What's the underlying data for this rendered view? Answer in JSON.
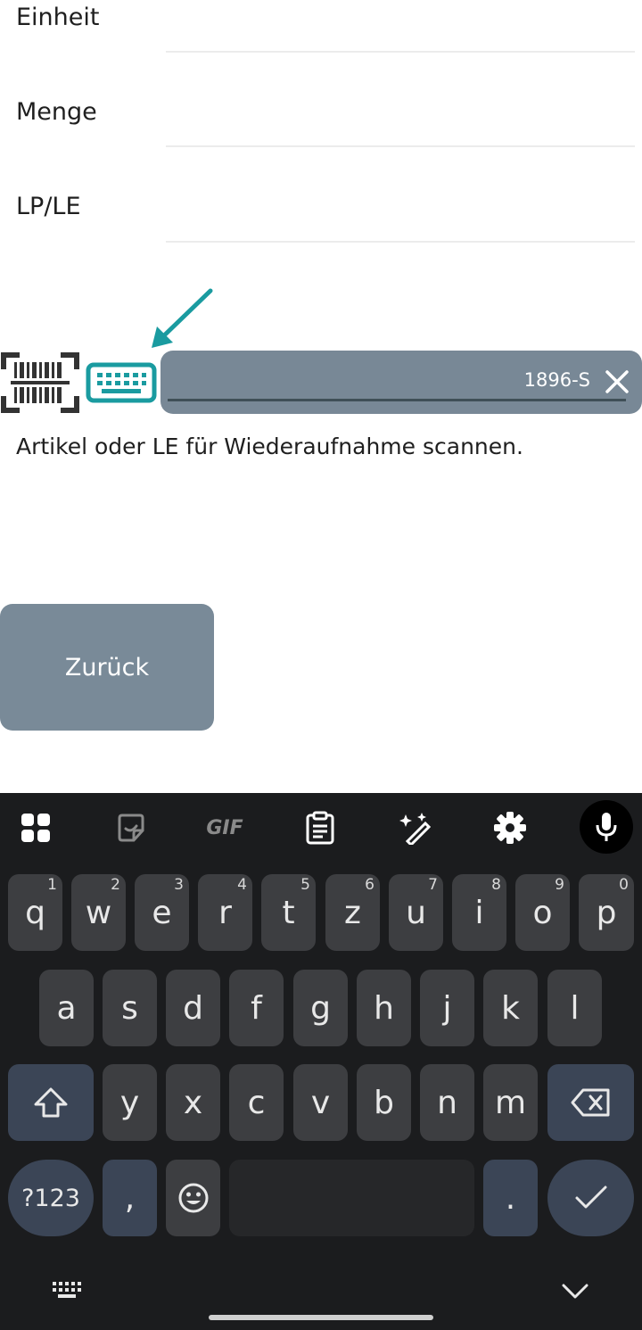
{
  "form": {
    "fields": [
      {
        "label": "Einheit"
      },
      {
        "label": "Menge"
      },
      {
        "label": "LP/LE"
      }
    ]
  },
  "scan": {
    "input_value": "1896-S",
    "hint": "Artikel oder LE für Wiederaufnahme scannen."
  },
  "actions": {
    "back_label": "Zurück"
  },
  "keyboard": {
    "toolbar": [
      "apps-icon",
      "sticker-icon",
      "GIF",
      "clipboard-icon",
      "magic-edit-icon",
      "settings-icon",
      "mic-icon"
    ],
    "gif_label": "GIF",
    "row1": [
      {
        "k": "q",
        "n": "1"
      },
      {
        "k": "w",
        "n": "2"
      },
      {
        "k": "e",
        "n": "3"
      },
      {
        "k": "r",
        "n": "4"
      },
      {
        "k": "t",
        "n": "5"
      },
      {
        "k": "z",
        "n": "6"
      },
      {
        "k": "u",
        "n": "7"
      },
      {
        "k": "i",
        "n": "8"
      },
      {
        "k": "o",
        "n": "9"
      },
      {
        "k": "p",
        "n": "0"
      }
    ],
    "row2": [
      "a",
      "s",
      "d",
      "f",
      "g",
      "h",
      "j",
      "k",
      "l"
    ],
    "row3": [
      "y",
      "x",
      "c",
      "v",
      "b",
      "n",
      "m"
    ],
    "symbols_label": "?123",
    "comma": ",",
    "period": ".",
    "colors": {
      "keyboard_bg": "#1b1c1e",
      "key": "#3d3e41",
      "accent_key": "#3b4556",
      "accent_teal": "#1a9ba0"
    }
  }
}
